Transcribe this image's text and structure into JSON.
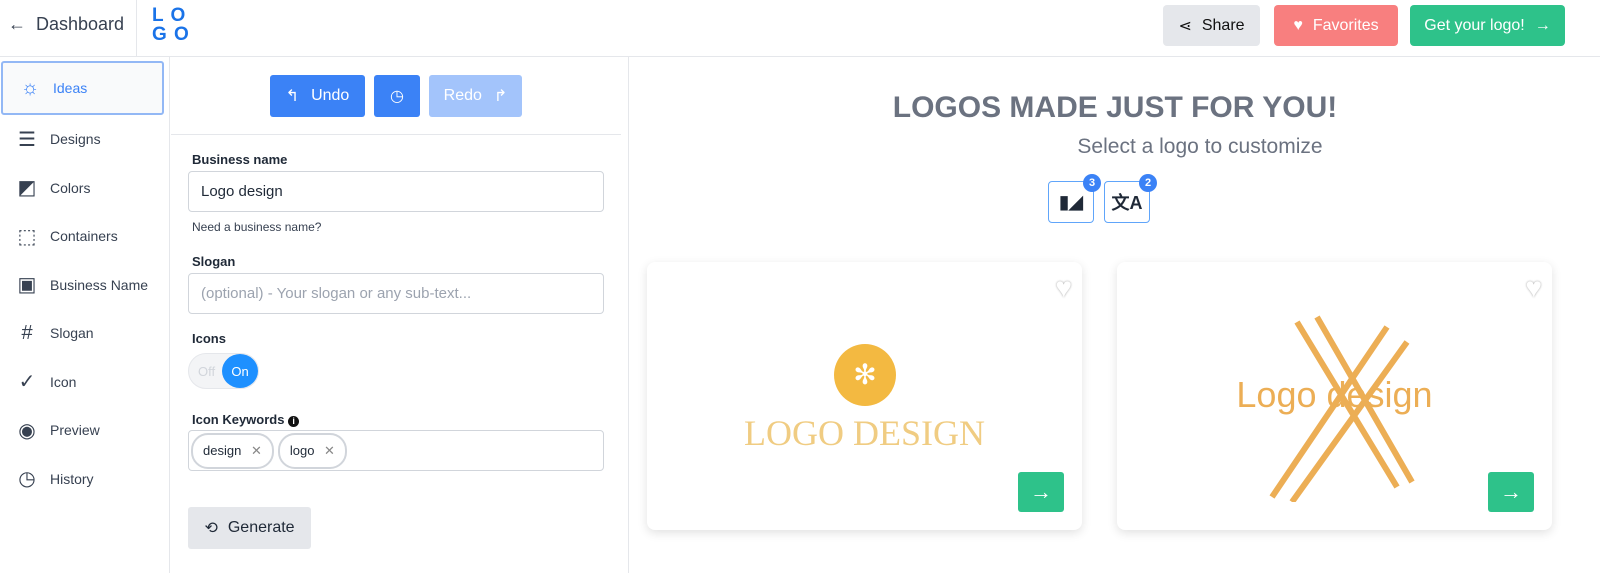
{
  "header": {
    "back_label": "Dashboard",
    "logo_text": "LOGO",
    "share": "Share",
    "favorites": "Favorites",
    "get_logo": "Get your logo!"
  },
  "sidebar": {
    "items": [
      {
        "label": "Ideas",
        "icon": "lightbulb-icon"
      },
      {
        "label": "Designs",
        "icon": "layers-icon"
      },
      {
        "label": "Colors",
        "icon": "palette-icon"
      },
      {
        "label": "Containers",
        "icon": "container-icon"
      },
      {
        "label": "Business Name",
        "icon": "id-card-icon"
      },
      {
        "label": "Slogan",
        "icon": "hash-icon"
      },
      {
        "label": "Icon",
        "icon": "badge-check-icon"
      },
      {
        "label": "Preview",
        "icon": "eye-icon"
      },
      {
        "label": "History",
        "icon": "clock-icon"
      }
    ]
  },
  "form": {
    "undo": "Undo",
    "redo": "Redo",
    "business_label": "Business name",
    "business_value": "Logo design",
    "business_help": "Need a business name?",
    "slogan_label": "Slogan",
    "slogan_placeholder": "(optional) - Your slogan or any sub-text...",
    "icons_label": "Icons",
    "toggle_off": "Off",
    "toggle_on": "On",
    "keywords_label": "Icon Keywords",
    "keywords": [
      "design",
      "logo"
    ],
    "generate": "Generate"
  },
  "main": {
    "title": "LOGOS MADE JUST FOR YOU!",
    "subtitle": "Select a logo to customize",
    "filter_badges": [
      "3",
      "2"
    ],
    "cards": [
      {
        "text": "LOGO DESIGN"
      },
      {
        "text": "Logo design"
      }
    ]
  },
  "colors": {
    "primary": "#3b82f6",
    "green": "#2ec28a",
    "favorites": "#f87f7f",
    "logo_gold": "#f0b43c"
  }
}
